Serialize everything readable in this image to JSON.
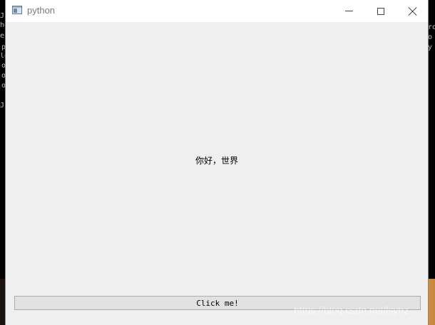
{
  "window": {
    "title": "python",
    "icon": "app-window-icon",
    "controls": {
      "minimize": "minimize-icon",
      "maximize": "maximize-icon",
      "close": "close-icon"
    }
  },
  "content": {
    "label": "你好，世界",
    "button_label": "Click me!"
  },
  "background": {
    "console_left": [
      "Js",
      "ho",
      "e",
      "p",
      "ld",
      "o",
      "o",
      "o",
      "",
      "Js"
    ],
    "console_right": [
      "ro",
      "o",
      "y"
    ]
  },
  "watermark": "https://blog.csdn.net/lsyhz"
}
